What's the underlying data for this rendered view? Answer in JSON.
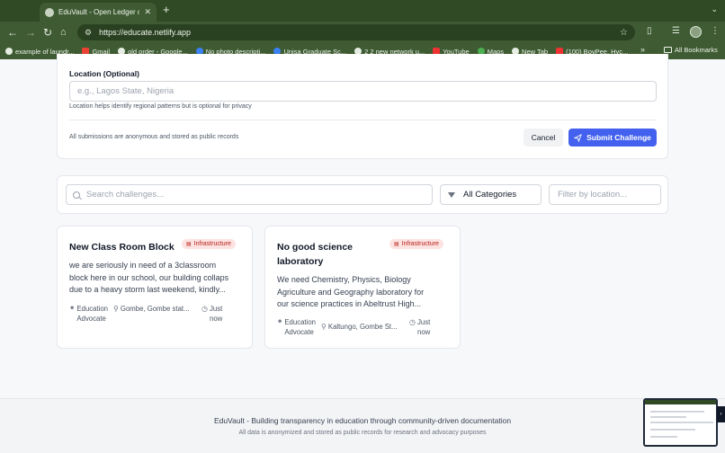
{
  "browser": {
    "tab_title": "EduVault - Open Ledger of E…",
    "tab_close": "✕",
    "new_tab": "+",
    "url": "https://educate.netlify.app",
    "bookmarks": [
      {
        "label": "example of laundr...",
        "icon": "google"
      },
      {
        "label": "Gmail",
        "icon": "gmail"
      },
      {
        "label": "old order - Google...",
        "icon": "google"
      },
      {
        "label": "No photo descripti...",
        "icon": "facebook"
      },
      {
        "label": "Unisa Graduate Sc...",
        "icon": "facebook"
      },
      {
        "label": "2 2 new network u...",
        "icon": "globe"
      },
      {
        "label": "YouTube",
        "icon": "youtube"
      },
      {
        "label": "Maps",
        "icon": "maps"
      },
      {
        "label": "New Tab",
        "icon": "globe"
      },
      {
        "label": "(100) BoyPee, Hyc...",
        "icon": "youtube"
      }
    ],
    "all_bookmarks": "All Bookmarks"
  },
  "form": {
    "location_label": "Location (Optional)",
    "location_placeholder": "e.g., Lagos State, Nigeria",
    "location_help": "Location helps identify regional patterns but is optional for privacy",
    "anonymous_note": "All submissions are anonymous and stored as public records",
    "cancel_label": "Cancel",
    "submit_label": "Submit Challenge"
  },
  "filters": {
    "search_placeholder": "Search challenges...",
    "category_value": "All Categories",
    "location_placeholder": "Filter by location..."
  },
  "challenges": [
    {
      "title": "New Class Room Block",
      "badge": "Infrastructure",
      "desc_lines": [
        "we are seriously in need of a 3classroom",
        "block here in our school, our building collaps",
        "due to a heavy storm last weekend, kindly..."
      ],
      "author_lines": [
        "Education",
        "Advocate"
      ],
      "location": "Gombe, Gombe stat...",
      "time_lines": [
        "Just",
        "now"
      ]
    },
    {
      "title_lines": [
        "No good science",
        "laboratory"
      ],
      "badge": "Infrastructure",
      "desc_lines": [
        "We need Chemistry, Physics, Biology",
        "Agriculture and Geography laboratory for",
        "our science practices in Abeltrust High..."
      ],
      "author_lines": [
        "Education",
        "Advocate"
      ],
      "location": "Kaltungo, Gombe St...",
      "time_lines": [
        "Just",
        "now"
      ]
    }
  ],
  "footer": {
    "main": "EduVault - Building transparency in education through community-driven documentation",
    "sub": "All data is anonymized and stored as public records for research and advocacy purposes"
  },
  "colors": {
    "primary": "#4361ee",
    "badge_bg": "#fde2e2",
    "badge_text": "#b42318",
    "chrome": "#3e5b33"
  }
}
